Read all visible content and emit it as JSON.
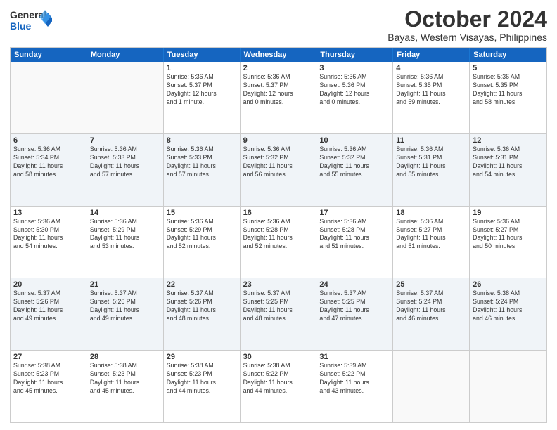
{
  "logo": {
    "line1": "General",
    "line2": "Blue"
  },
  "title": "October 2024",
  "subtitle": "Bayas, Western Visayas, Philippines",
  "header_days": [
    "Sunday",
    "Monday",
    "Tuesday",
    "Wednesday",
    "Thursday",
    "Friday",
    "Saturday"
  ],
  "weeks": [
    [
      {
        "day": "",
        "lines": []
      },
      {
        "day": "",
        "lines": []
      },
      {
        "day": "1",
        "lines": [
          "Sunrise: 5:36 AM",
          "Sunset: 5:37 PM",
          "Daylight: 12 hours",
          "and 1 minute."
        ]
      },
      {
        "day": "2",
        "lines": [
          "Sunrise: 5:36 AM",
          "Sunset: 5:37 PM",
          "Daylight: 12 hours",
          "and 0 minutes."
        ]
      },
      {
        "day": "3",
        "lines": [
          "Sunrise: 5:36 AM",
          "Sunset: 5:36 PM",
          "Daylight: 12 hours",
          "and 0 minutes."
        ]
      },
      {
        "day": "4",
        "lines": [
          "Sunrise: 5:36 AM",
          "Sunset: 5:35 PM",
          "Daylight: 11 hours",
          "and 59 minutes."
        ]
      },
      {
        "day": "5",
        "lines": [
          "Sunrise: 5:36 AM",
          "Sunset: 5:35 PM",
          "Daylight: 11 hours",
          "and 58 minutes."
        ]
      }
    ],
    [
      {
        "day": "6",
        "lines": [
          "Sunrise: 5:36 AM",
          "Sunset: 5:34 PM",
          "Daylight: 11 hours",
          "and 58 minutes."
        ]
      },
      {
        "day": "7",
        "lines": [
          "Sunrise: 5:36 AM",
          "Sunset: 5:33 PM",
          "Daylight: 11 hours",
          "and 57 minutes."
        ]
      },
      {
        "day": "8",
        "lines": [
          "Sunrise: 5:36 AM",
          "Sunset: 5:33 PM",
          "Daylight: 11 hours",
          "and 57 minutes."
        ]
      },
      {
        "day": "9",
        "lines": [
          "Sunrise: 5:36 AM",
          "Sunset: 5:32 PM",
          "Daylight: 11 hours",
          "and 56 minutes."
        ]
      },
      {
        "day": "10",
        "lines": [
          "Sunrise: 5:36 AM",
          "Sunset: 5:32 PM",
          "Daylight: 11 hours",
          "and 55 minutes."
        ]
      },
      {
        "day": "11",
        "lines": [
          "Sunrise: 5:36 AM",
          "Sunset: 5:31 PM",
          "Daylight: 11 hours",
          "and 55 minutes."
        ]
      },
      {
        "day": "12",
        "lines": [
          "Sunrise: 5:36 AM",
          "Sunset: 5:31 PM",
          "Daylight: 11 hours",
          "and 54 minutes."
        ]
      }
    ],
    [
      {
        "day": "13",
        "lines": [
          "Sunrise: 5:36 AM",
          "Sunset: 5:30 PM",
          "Daylight: 11 hours",
          "and 54 minutes."
        ]
      },
      {
        "day": "14",
        "lines": [
          "Sunrise: 5:36 AM",
          "Sunset: 5:29 PM",
          "Daylight: 11 hours",
          "and 53 minutes."
        ]
      },
      {
        "day": "15",
        "lines": [
          "Sunrise: 5:36 AM",
          "Sunset: 5:29 PM",
          "Daylight: 11 hours",
          "and 52 minutes."
        ]
      },
      {
        "day": "16",
        "lines": [
          "Sunrise: 5:36 AM",
          "Sunset: 5:28 PM",
          "Daylight: 11 hours",
          "and 52 minutes."
        ]
      },
      {
        "day": "17",
        "lines": [
          "Sunrise: 5:36 AM",
          "Sunset: 5:28 PM",
          "Daylight: 11 hours",
          "and 51 minutes."
        ]
      },
      {
        "day": "18",
        "lines": [
          "Sunrise: 5:36 AM",
          "Sunset: 5:27 PM",
          "Daylight: 11 hours",
          "and 51 minutes."
        ]
      },
      {
        "day": "19",
        "lines": [
          "Sunrise: 5:36 AM",
          "Sunset: 5:27 PM",
          "Daylight: 11 hours",
          "and 50 minutes."
        ]
      }
    ],
    [
      {
        "day": "20",
        "lines": [
          "Sunrise: 5:37 AM",
          "Sunset: 5:26 PM",
          "Daylight: 11 hours",
          "and 49 minutes."
        ]
      },
      {
        "day": "21",
        "lines": [
          "Sunrise: 5:37 AM",
          "Sunset: 5:26 PM",
          "Daylight: 11 hours",
          "and 49 minutes."
        ]
      },
      {
        "day": "22",
        "lines": [
          "Sunrise: 5:37 AM",
          "Sunset: 5:26 PM",
          "Daylight: 11 hours",
          "and 48 minutes."
        ]
      },
      {
        "day": "23",
        "lines": [
          "Sunrise: 5:37 AM",
          "Sunset: 5:25 PM",
          "Daylight: 11 hours",
          "and 48 minutes."
        ]
      },
      {
        "day": "24",
        "lines": [
          "Sunrise: 5:37 AM",
          "Sunset: 5:25 PM",
          "Daylight: 11 hours",
          "and 47 minutes."
        ]
      },
      {
        "day": "25",
        "lines": [
          "Sunrise: 5:37 AM",
          "Sunset: 5:24 PM",
          "Daylight: 11 hours",
          "and 46 minutes."
        ]
      },
      {
        "day": "26",
        "lines": [
          "Sunrise: 5:38 AM",
          "Sunset: 5:24 PM",
          "Daylight: 11 hours",
          "and 46 minutes."
        ]
      }
    ],
    [
      {
        "day": "27",
        "lines": [
          "Sunrise: 5:38 AM",
          "Sunset: 5:23 PM",
          "Daylight: 11 hours",
          "and 45 minutes."
        ]
      },
      {
        "day": "28",
        "lines": [
          "Sunrise: 5:38 AM",
          "Sunset: 5:23 PM",
          "Daylight: 11 hours",
          "and 45 minutes."
        ]
      },
      {
        "day": "29",
        "lines": [
          "Sunrise: 5:38 AM",
          "Sunset: 5:23 PM",
          "Daylight: 11 hours",
          "and 44 minutes."
        ]
      },
      {
        "day": "30",
        "lines": [
          "Sunrise: 5:38 AM",
          "Sunset: 5:22 PM",
          "Daylight: 11 hours",
          "and 44 minutes."
        ]
      },
      {
        "day": "31",
        "lines": [
          "Sunrise: 5:39 AM",
          "Sunset: 5:22 PM",
          "Daylight: 11 hours",
          "and 43 minutes."
        ]
      },
      {
        "day": "",
        "lines": []
      },
      {
        "day": "",
        "lines": []
      }
    ]
  ]
}
